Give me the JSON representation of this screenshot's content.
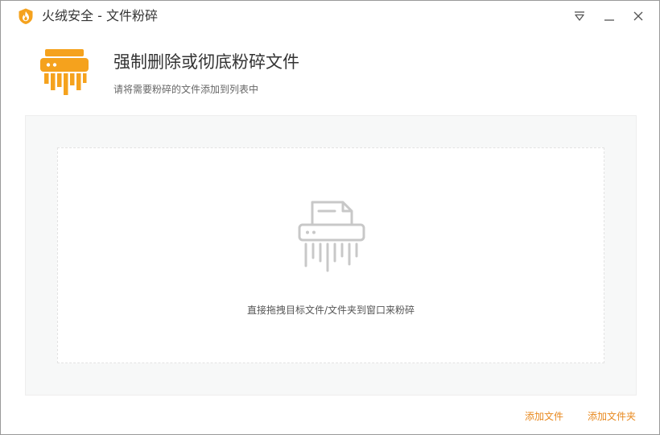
{
  "window": {
    "title": "火绒安全 - 文件粉碎"
  },
  "titlebar": {
    "icons": [
      "flame-logo-icon",
      "menu-dropdown-icon",
      "minimize-icon",
      "close-icon"
    ]
  },
  "header": {
    "title": "强制删除或彻底粉碎文件",
    "subtitle": "请将需要粉碎的文件添加到列表中",
    "icon": "shredder-icon"
  },
  "dropzone": {
    "hint": "直接拖拽目标文件/文件夹到窗口来粉碎",
    "icon": "shredder-outline-icon"
  },
  "footer": {
    "add_file_label": "添加文件",
    "add_folder_label": "添加文件夹"
  },
  "colors": {
    "accent": "#f5a21d",
    "link": "#e8891f",
    "dropzone_bg": "#f7f8f8",
    "icon_gray": "#c8c8c8"
  }
}
